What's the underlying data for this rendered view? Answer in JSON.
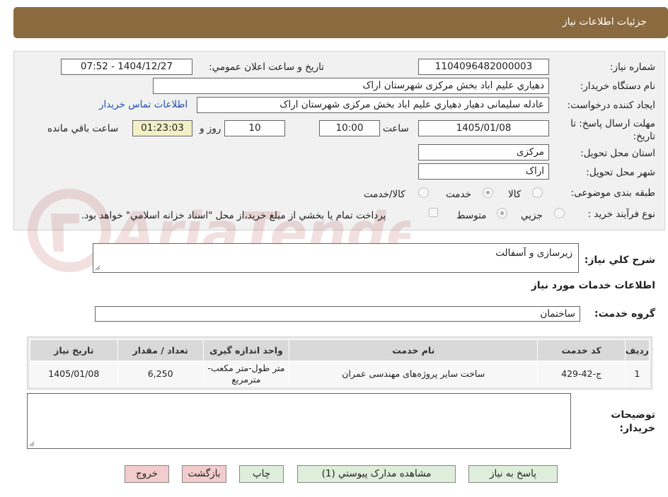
{
  "header": {
    "title": "جزئيات اطلاعات نياز"
  },
  "form": {
    "need_number_label": "شماره نياز:",
    "need_number": "1104096482000003",
    "announce_label": "تاريخ و ساعت اعلان عمومي:",
    "announce_value": "1404/12/27 - 07:52",
    "buyer_org_label": "نام دستگاه خريدار:",
    "buyer_org": "دهياري عليم اباد بخش مرکزی  شهرستان اراک",
    "requester_label": "ايجاد کننده درخواست:",
    "requester": "عادله سلیمانی دهيار دهياري عليم اباد بخش مرکزی  شهرستان اراک",
    "contact_link": "اطلاعات تماس خريدار",
    "deadline_label": "مهلت ارسال پاسخ: تا تاريخ:",
    "deadline_date": "1405/01/08",
    "time_label": "ساعت",
    "deadline_time": "10:00",
    "days_value": "10",
    "days_label": "روز و",
    "remaining_time": "01:23:03",
    "remaining_label": "ساعت باقي مانده",
    "province_label": "استان محل تحويل:",
    "province": "مرکزی",
    "city_label": "شهر محل تحويل:",
    "city": "اراک",
    "category_label": "طبقه بندی موضوعی:",
    "category_options": [
      "کالا",
      "خدمت",
      "کالا/خدمت"
    ],
    "category_selected": "خدمت",
    "process_label": "نوع فرآيند خريد :",
    "process_options": [
      "جزيي",
      "متوسط"
    ],
    "process_selected": "متوسط",
    "payment_note": "پرداخت تمام يا بخشي از مبلغ خريد،از محل \"اسناد خزانه اسلامي\" خواهد بود."
  },
  "summary": {
    "label": "شرح كلي نياز:",
    "value": "زيرسازی و آسفالت"
  },
  "services": {
    "section_title": "اطلاعات خدمات مورد نياز",
    "group_label": "گروه خدمت:",
    "group_value": "ساختمان",
    "columns": [
      "رديف",
      "کد خدمت",
      "نام خدمت",
      "واحد اندازه گيری",
      "تعداد / مقدار",
      "تاريخ نياز"
    ],
    "rows": [
      {
        "index": "1",
        "code": "ج-42-429",
        "name": "ساخت ساير پروژه‌های مهندسی عمران",
        "unit": "متر طول-متر مکعب-مترمربع",
        "qty": "6,250",
        "date": "1405/01/08"
      }
    ]
  },
  "buyer_notes": {
    "label": "توضيحات خريدار:",
    "value": ""
  },
  "buttons": {
    "reply": "پاسخ به نياز",
    "attachments": "مشاهده مدارک پيوستي (1)",
    "print": "چاپ",
    "back": "بازگشت",
    "exit": "خروج"
  },
  "watermark": {
    "text": "AriaTender.neT"
  },
  "colors": {
    "header": "#8b6a3f",
    "link": "#1f4fb3",
    "green_button": "#dfeeda",
    "pink_button": "#f2cccc"
  },
  "icons": [
    "logo-watermark-icon",
    "resize-grip-icon"
  ]
}
